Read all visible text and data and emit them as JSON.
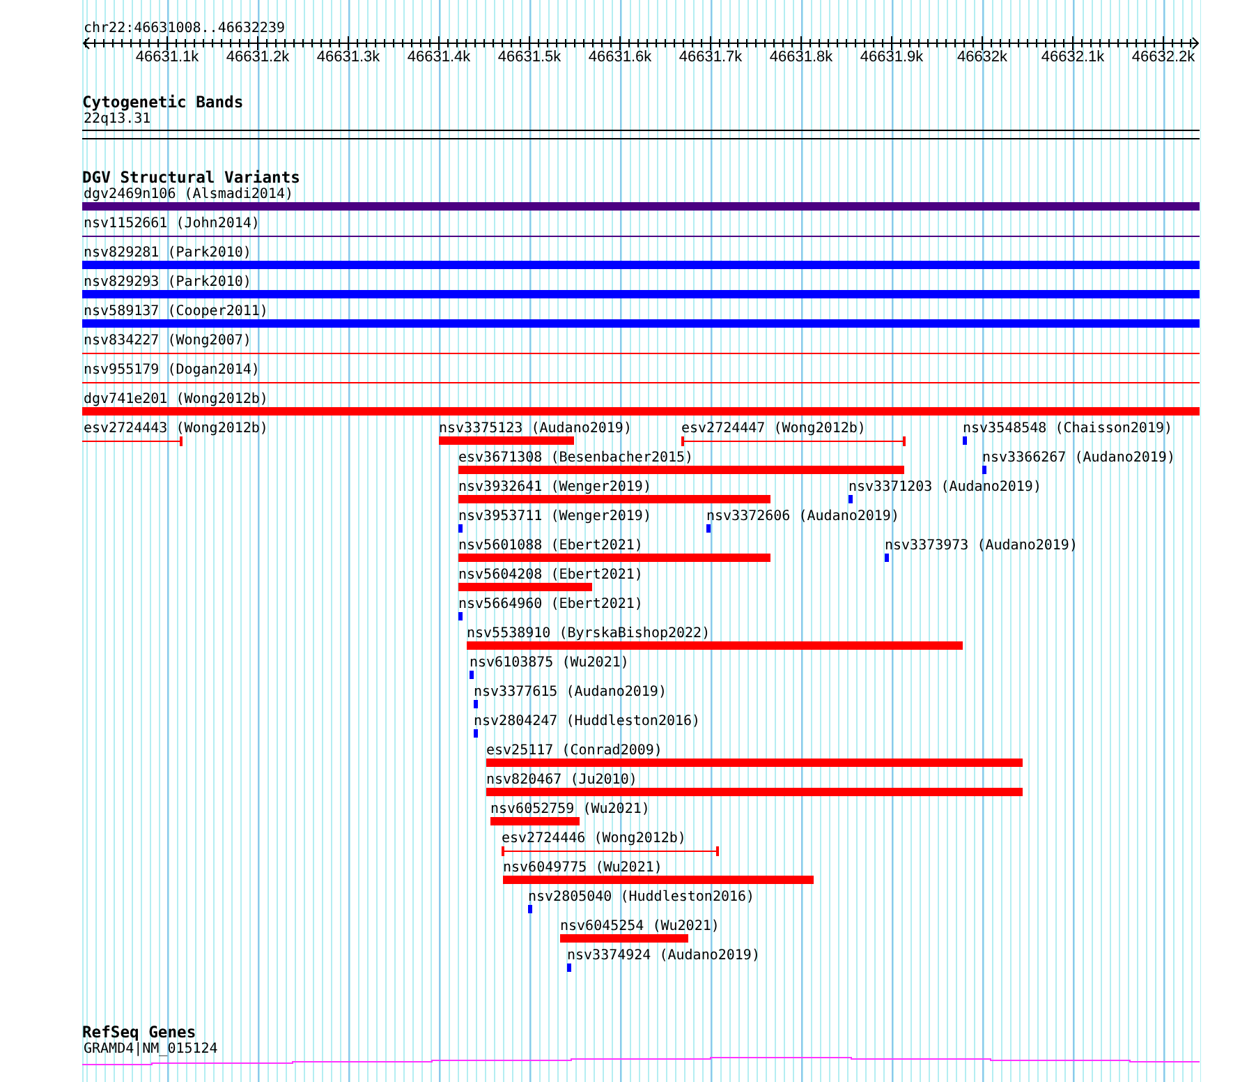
{
  "ruler": {
    "location": "chr22:46631008..46632239",
    "ticks": [
      "46631.1k",
      "46631.2k",
      "46631.3k",
      "46631.4k",
      "46631.5k",
      "46631.6k",
      "46631.7k",
      "46631.8k",
      "46631.9k",
      "46632k",
      "46632.1k",
      "46632.2k"
    ]
  },
  "tracks": [
    {
      "kind": "cytoband",
      "title": "Cytogenetic Bands",
      "features": [
        {
          "label": "22q13.31"
        }
      ]
    },
    {
      "kind": "variants",
      "title": "DGV Structural Variants",
      "rows": [
        [
          {
            "label": "dgv2469n106 (Alsmadi2014)",
            "kind": "bar",
            "color": "#4b0082"
          }
        ],
        [
          {
            "label": "nsv1152661 (John2014)",
            "kind": "line",
            "color": "#4b0082"
          }
        ],
        [
          {
            "label": "nsv829281 (Park2010)",
            "kind": "bar",
            "color": "#0000ff"
          }
        ],
        [
          {
            "label": "nsv829293 (Park2010)",
            "kind": "bar",
            "color": "#0000ff"
          }
        ],
        [
          {
            "label": "nsv589137 (Cooper2011)",
            "kind": "bar",
            "color": "#0000ff"
          }
        ],
        [
          {
            "label": "nsv834227 (Wong2007)",
            "kind": "line",
            "color": "#ff0000"
          }
        ],
        [
          {
            "label": "nsv955179 (Dogan2014)",
            "kind": "line",
            "color": "#ff0000"
          }
        ],
        [
          {
            "label": "dgv741e201 (Wong2012b)",
            "kind": "bar",
            "color": "#ff0000"
          }
        ],
        [
          {
            "label": "esv2724443 (Wong2012b)",
            "kind": "span",
            "color": "#ff0000"
          },
          {
            "label": "nsv3375123 (Audano2019)",
            "kind": "bar",
            "color": "#ff0000"
          },
          {
            "label": "esv2724447 (Wong2012b)",
            "kind": "span",
            "color": "#ff0000"
          },
          {
            "label": "nsv3548548 (Chaisson2019)",
            "kind": "bar",
            "color": "#0000ff"
          }
        ],
        [
          {
            "label": "esv3671308 (Besenbacher2015)",
            "kind": "bar",
            "color": "#ff0000"
          },
          {
            "label": "nsv3366267 (Audano2019)",
            "kind": "bar",
            "color": "#0000ff"
          }
        ],
        [
          {
            "label": "nsv3932641 (Wenger2019)",
            "kind": "bar",
            "color": "#ff0000"
          },
          {
            "label": "nsv3371203 (Audano2019)",
            "kind": "bar",
            "color": "#0000ff"
          }
        ],
        [
          {
            "label": "nsv3953711 (Wenger2019)",
            "kind": "bar",
            "color": "#0000ff"
          },
          {
            "label": "nsv3372606 (Audano2019)",
            "kind": "bar",
            "color": "#0000ff"
          }
        ],
        [
          {
            "label": "nsv5601088 (Ebert2021)",
            "kind": "bar",
            "color": "#ff0000"
          },
          {
            "label": "nsv3373973 (Audano2019)",
            "kind": "bar",
            "color": "#0000ff"
          }
        ],
        [
          {
            "label": "nsv5604208 (Ebert2021)",
            "kind": "bar",
            "color": "#ff0000"
          }
        ],
        [
          {
            "label": "nsv5664960 (Ebert2021)",
            "kind": "bar",
            "color": "#0000ff"
          }
        ],
        [
          {
            "label": "nsv5538910 (ByrskaBishop2022)",
            "kind": "bar",
            "color": "#ff0000"
          }
        ],
        [
          {
            "label": "nsv6103875 (Wu2021)",
            "kind": "bar",
            "color": "#0000ff"
          }
        ],
        [
          {
            "label": "nsv3377615 (Audano2019)",
            "kind": "bar",
            "color": "#0000ff"
          }
        ],
        [
          {
            "label": "nsv2804247 (Huddleston2016)",
            "kind": "bar",
            "color": "#0000ff"
          }
        ],
        [
          {
            "label": "esv25117 (Conrad2009)",
            "kind": "bar",
            "color": "#ff0000"
          }
        ],
        [
          {
            "label": "nsv820467 (Ju2010)",
            "kind": "bar",
            "color": "#ff0000"
          }
        ],
        [
          {
            "label": "nsv6052759 (Wu2021)",
            "kind": "bar",
            "color": "#ff0000"
          }
        ],
        [
          {
            "label": "esv2724446 (Wong2012b)",
            "kind": "span",
            "color": "#ff0000"
          }
        ],
        [
          {
            "label": "nsv6049775 (Wu2021)",
            "kind": "bar",
            "color": "#ff0000"
          }
        ],
        [
          {
            "label": "nsv2805040 (Huddleston2016)",
            "kind": "bar",
            "color": "#0000ff"
          }
        ],
        [
          {
            "label": "nsv6045254 (Wu2021)",
            "kind": "bar",
            "color": "#ff0000"
          }
        ],
        [
          {
            "label": "nsv3374924 (Audano2019)",
            "kind": "bar",
            "color": "#0000ff"
          }
        ]
      ]
    },
    {
      "kind": "genes",
      "title": "RefSeq Genes",
      "features": [
        {
          "label": "GRAMD4|NM_015124"
        }
      ]
    }
  ]
}
